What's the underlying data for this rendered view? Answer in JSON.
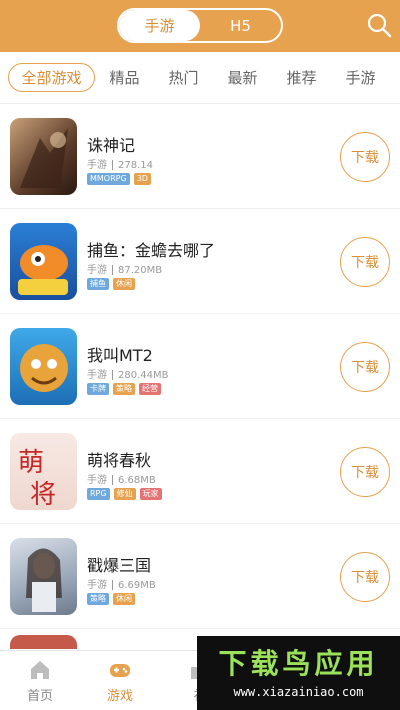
{
  "header": {
    "tabs": [
      {
        "label": "手游",
        "active": true
      },
      {
        "label": "H5",
        "active": false
      }
    ],
    "search_icon": "search-icon",
    "accent_color": "#e6a24f"
  },
  "categories": [
    "全部游戏",
    "精品",
    "热门",
    "最新",
    "推荐",
    "手游"
  ],
  "games": [
    {
      "name": "诛神记",
      "type": "手游",
      "size": "278.14",
      "tags": [
        {
          "text": "MMORPG",
          "color": "#6fa8dc"
        },
        {
          "text": "3D",
          "color": "#e6a24f"
        }
      ],
      "download": "下载"
    },
    {
      "name": "捕鱼：金蟾去哪了",
      "type": "手游",
      "size": "87.20MB",
      "tags": [
        {
          "text": "捕鱼",
          "color": "#6fa8dc"
        },
        {
          "text": "休闲",
          "color": "#e6a24f"
        }
      ],
      "download": "下载"
    },
    {
      "name": "我叫MT2",
      "type": "手游",
      "size": "280.44MB",
      "tags": [
        {
          "text": "卡牌",
          "color": "#6fa8dc"
        },
        {
          "text": "策略",
          "color": "#e6a24f"
        },
        {
          "text": "经营",
          "color": "#e57373"
        }
      ],
      "download": "下载"
    },
    {
      "name": "萌将春秋",
      "type": "手游",
      "size": "6.68MB",
      "tags": [
        {
          "text": "RPG",
          "color": "#6fa8dc"
        },
        {
          "text": "修仙",
          "color": "#e6a24f"
        },
        {
          "text": "玩家",
          "color": "#e57373"
        }
      ],
      "download": "下载"
    },
    {
      "name": "戳爆三国",
      "type": "手游",
      "size": "6.69MB",
      "tags": [
        {
          "text": "策略",
          "color": "#6fa8dc"
        },
        {
          "text": "休闲",
          "color": "#e6a24f"
        }
      ],
      "download": "下载"
    }
  ],
  "tabbar": [
    {
      "label": "首页",
      "icon": "home-icon",
      "active": false
    },
    {
      "label": "游戏",
      "icon": "gamepad-icon",
      "active": true
    },
    {
      "label": "礼",
      "icon": "gift-icon",
      "active": false
    }
  ],
  "watermark": {
    "title": "下载鸟应用",
    "url": "www.xiazainiao.com"
  }
}
